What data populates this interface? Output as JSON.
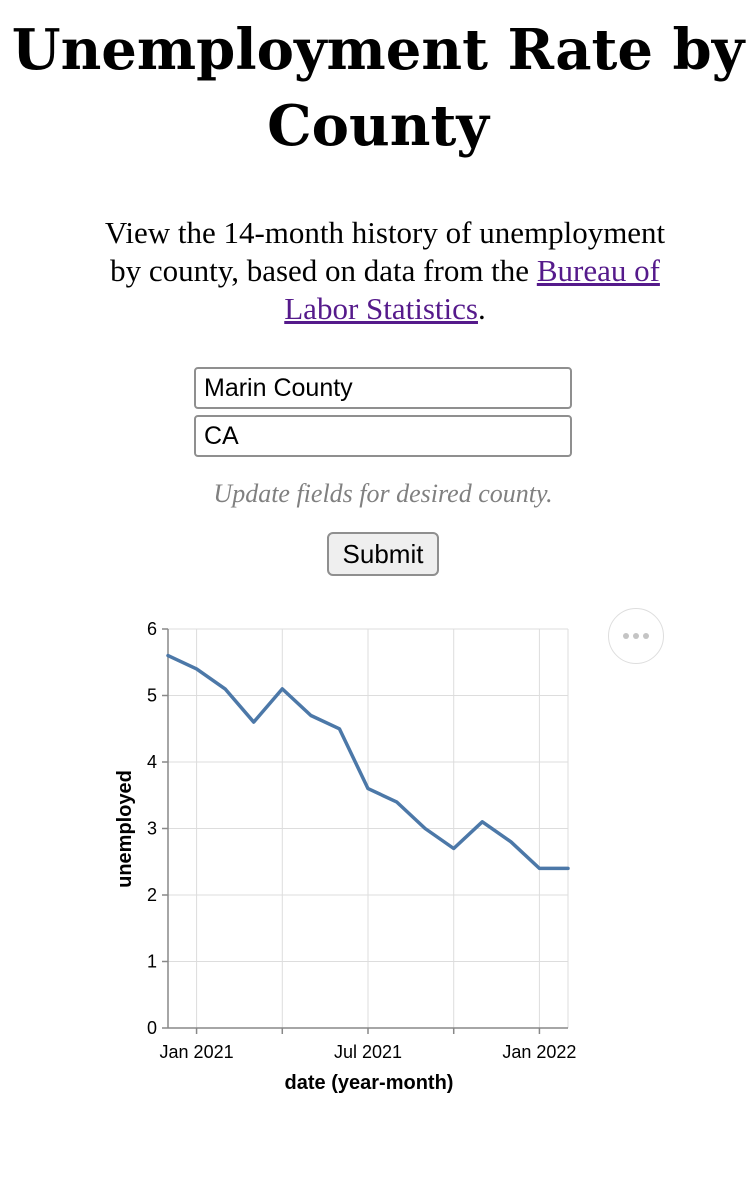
{
  "page": {
    "title": "Unemployment Rate by County",
    "intro_text": "View the 14-month history of unemployment by county, based on data from the ",
    "intro_link": "Bureau of Labor Statistics",
    "intro_end": "."
  },
  "form": {
    "county_value": "Marin County",
    "state_value": "CA",
    "hint": "Update fields for desired county.",
    "submit_label": "Submit"
  },
  "chart_actions": {
    "icon": "ellipsis-icon"
  },
  "colors": {
    "line": "#4c78a8",
    "link": "#551a8b",
    "grid": "#dddddd",
    "axis": "#888888"
  },
  "chart_data": {
    "type": "line",
    "xlabel": "date (year-month)",
    "ylabel": "unemployed",
    "ylim": [
      0,
      6
    ],
    "yticks": [
      0,
      1,
      2,
      3,
      4,
      5,
      6
    ],
    "xlim": [
      "2020-12",
      "2022-02"
    ],
    "xticks": [
      {
        "value": "2021-01",
        "label": "Jan 2021"
      },
      {
        "value": "2021-04",
        "label": ""
      },
      {
        "value": "2021-07",
        "label": "Jul 2021"
      },
      {
        "value": "2021-10",
        "label": ""
      },
      {
        "value": "2022-01",
        "label": "Jan 2022"
      }
    ],
    "grid": true,
    "series": [
      {
        "x": [
          "2020-12",
          "2021-01",
          "2021-02",
          "2021-03",
          "2021-04",
          "2021-05",
          "2021-06",
          "2021-07",
          "2021-08",
          "2021-09",
          "2021-10",
          "2021-11",
          "2021-12",
          "2022-01",
          "2022-02"
        ],
        "y": [
          5.6,
          5.4,
          5.1,
          4.6,
          5.1,
          4.7,
          4.5,
          3.6,
          3.4,
          3.0,
          2.7,
          3.1,
          2.8,
          2.4,
          2.4
        ]
      }
    ]
  }
}
